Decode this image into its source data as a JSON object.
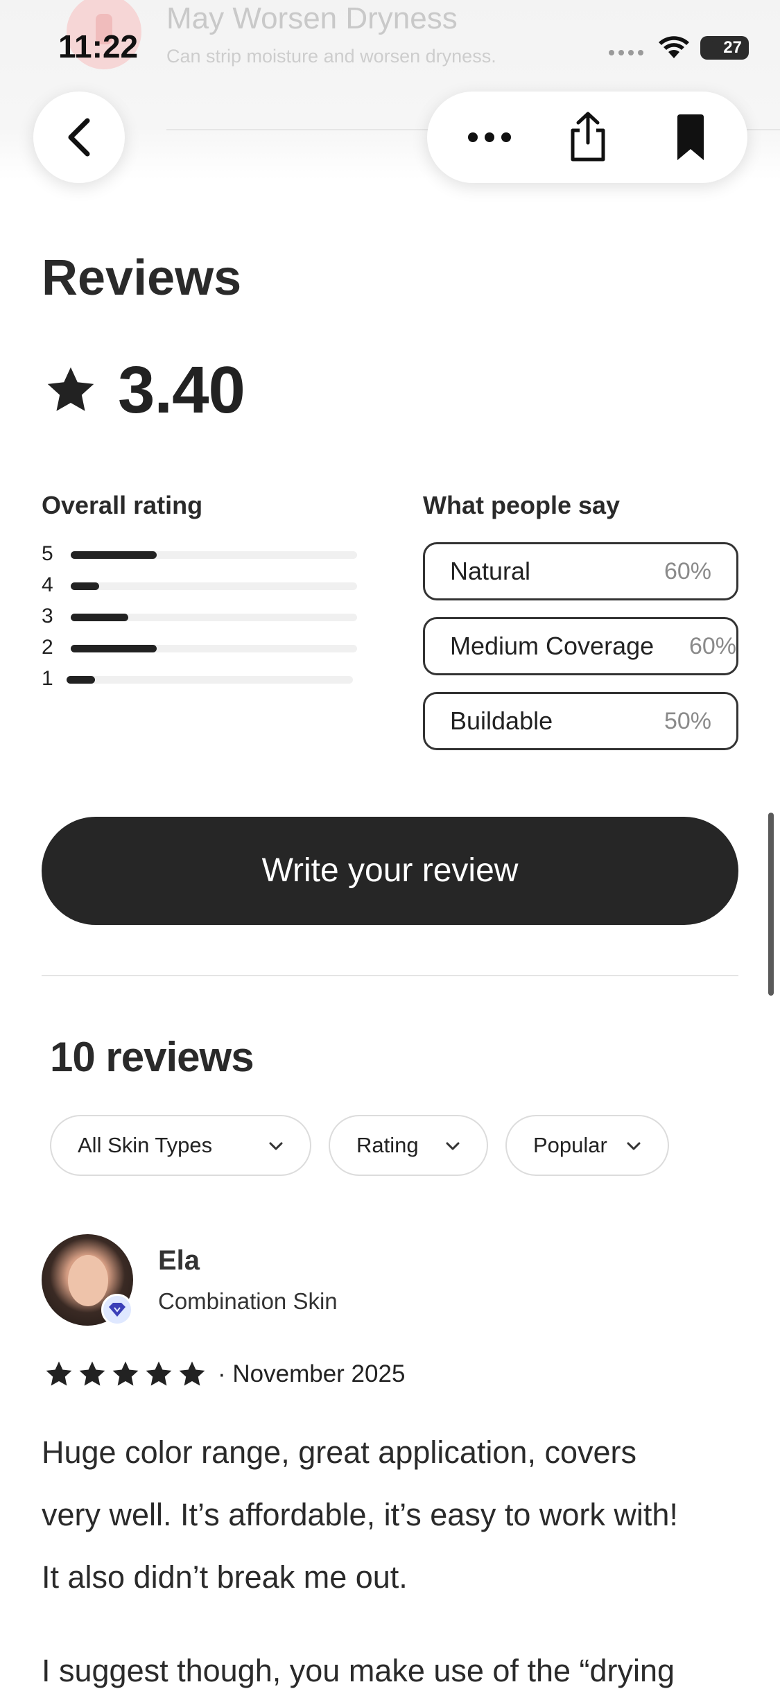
{
  "status_bar": {
    "time": "11:22",
    "battery": "27"
  },
  "faded_header": {
    "title": "May Worsen Dryness",
    "subtitle": "Can strip moisture and worsen dryness."
  },
  "nav": {
    "back_icon": "chevron-left-icon",
    "more_icon": "more-horizontal-icon",
    "share_icon": "share-icon",
    "bookmark_icon": "bookmark-icon"
  },
  "reviews": {
    "title": "Reviews",
    "average": "3.40",
    "overall_title": "Overall rating",
    "distribution": [
      {
        "stars": "5",
        "fraction": 0.3
      },
      {
        "stars": "4",
        "fraction": 0.1
      },
      {
        "stars": "3",
        "fraction": 0.2
      },
      {
        "stars": "2",
        "fraction": 0.3
      },
      {
        "stars": "1",
        "fraction": 0.1
      }
    ],
    "people_say_title": "What people say",
    "tags": [
      {
        "label": "Natural",
        "percent": "60%"
      },
      {
        "label": "Medium Coverage",
        "percent": "60%"
      },
      {
        "label": "Buildable",
        "percent": "50%"
      }
    ],
    "write_button": "Write your review",
    "count_title": "10 reviews",
    "filters": {
      "skin": "All Skin Types",
      "rating": "Rating",
      "sort": "Popular"
    }
  },
  "review": {
    "name": "Ela",
    "skin_type": "Combination Skin",
    "rating": 5,
    "date": "· November 2025",
    "paragraph_1_line_1": "Huge color range, great application, covers",
    "paragraph_1_line_2": "very well. It’s affordable, it’s easy to work with!",
    "paragraph_1_line_3": "It also didn’t break me out.",
    "paragraph_2_line_1": "I suggest though, you make use of the “drying"
  },
  "colors": {
    "primary": "#262626",
    "track": "#f0f0f0",
    "muted": "#8a8a8a",
    "badge": "#3b3fb8"
  }
}
